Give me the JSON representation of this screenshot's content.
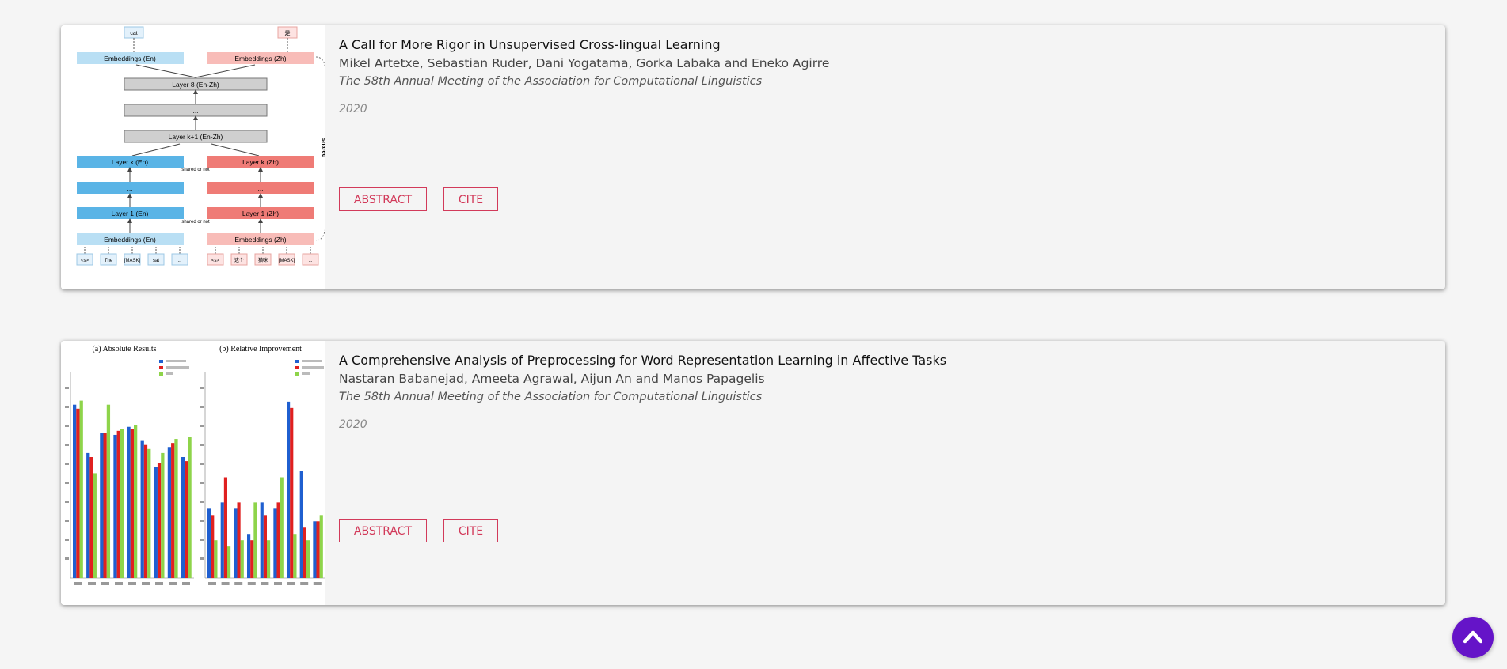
{
  "publications": [
    {
      "title": "A Call for More Rigor in Unsupervised Cross-lingual Learning",
      "authors": "Mikel Artetxe, Sebastian Ruder, Dani Yogatama, Gorka Labaka and Eneko Agirre",
      "venue": "The 58th Annual Meeting of the Association for Computational Linguistics",
      "year": "2020",
      "abstract_label": "ABSTRACT",
      "cite_label": "CITE",
      "thumbnail": {
        "type": "architecture-diagram",
        "top_left": "cat",
        "top_right": "是",
        "emb_en": "Embeddings (En)",
        "emb_zh": "Embeddings (Zh)",
        "layer_top": "Layer 8 (En-Zh)",
        "ellipsis": "...",
        "layer_mid": "Layer k+1 (En-Zh)",
        "layer_k_en": "Layer k (En)",
        "layer_k_zh": "Layer k (Zh)",
        "layer_1_en": "Layer 1 (En)",
        "layer_1_zh": "Layer 1 (Zh)",
        "shared_or_not": "shared or not",
        "shared": "shared",
        "tokens_en": [
          "<s>",
          "The",
          "[MASK]",
          "sat",
          "..."
        ],
        "tokens_zh": [
          "<s>",
          "这个",
          "猫咪",
          "[MASK]",
          "..."
        ]
      }
    },
    {
      "title": "A Comprehensive Analysis of Preprocessing for Word Representation Learning in Affective Tasks",
      "authors": "Nastaran Babanejad, Ameeta Agrawal, Aijun An and Manos Papagelis",
      "venue": "The 58th Annual Meeting of the Association for Computational Linguistics",
      "year": "2020",
      "abstract_label": "ABSTRACT",
      "cite_label": "CITE",
      "thumbnail": {
        "type": "bar-chart-figure",
        "panel_a_title": "(a) Absolute Results",
        "panel_b_title": "(b) Relative Improvement",
        "colors": [
          "#1f5fd0",
          "#e02020",
          "#8ed44a"
        ],
        "panel_a_values": [
          [
            86,
            84,
            88
          ],
          [
            62,
            60,
            52
          ],
          [
            72,
            72,
            86
          ],
          [
            71,
            73,
            74
          ],
          [
            75,
            74,
            76
          ],
          [
            68,
            66,
            64
          ],
          [
            55,
            57,
            62
          ],
          [
            65,
            67,
            69
          ],
          [
            60,
            58,
            70
          ]
        ],
        "panel_b_values": [
          [
            5.5,
            5,
            3
          ],
          [
            6,
            8,
            2.5
          ],
          [
            5.5,
            6,
            3
          ],
          [
            3.5,
            3,
            6
          ],
          [
            6,
            5,
            3
          ],
          [
            5.5,
            6,
            8
          ],
          [
            14,
            13.5,
            3.5
          ],
          [
            8.5,
            4,
            3
          ],
          [
            4.5,
            4.5,
            5
          ]
        ]
      }
    }
  ],
  "back_to_top_icon": "chevron-up-icon"
}
